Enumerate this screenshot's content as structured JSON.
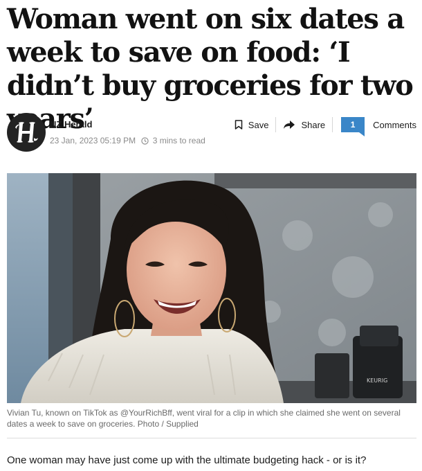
{
  "article": {
    "headline": "Woman went on six dates a week to save on food: ‘I didn’t buy groceries for two years’",
    "source": "NZ Herald",
    "date": "23 Jan, 2023 05:19 PM",
    "read_time": "3 mins to read",
    "actions": {
      "save_label": "Save",
      "share_label": "Share",
      "comment_count": "1",
      "comments_label": "Comments"
    },
    "image_brand_text": "KEURIG",
    "caption": "Vivian Tu, known on TikTok as @YourRichBff, went viral for a clip in which she claimed she went on several dates a week to save on groceries. Photo / Supplied",
    "lede": "One woman may have just come up with the ultimate budgeting hack - or is it?"
  },
  "colors": {
    "accent": "#3a86c8",
    "logo_bg": "#232323",
    "meta_text": "#8a8a8a"
  },
  "icons": {
    "logo": "nz-herald-h-logo",
    "save": "bookmark-icon",
    "share": "share-arrow-icon",
    "clock": "clock-icon"
  }
}
